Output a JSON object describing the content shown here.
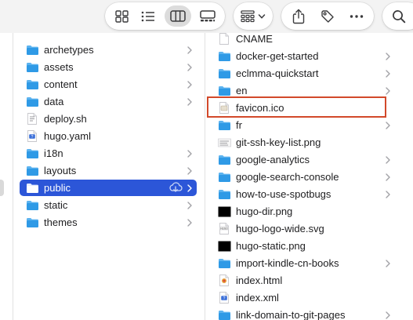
{
  "toolbar": {
    "view_buttons": [
      {
        "icon": "icon-view-icon",
        "active": false
      },
      {
        "icon": "list-view-icon",
        "active": false
      },
      {
        "icon": "column-view-icon",
        "active": true
      },
      {
        "icon": "gallery-view-icon",
        "active": false
      }
    ],
    "group_button_icon": "group-by-icon",
    "share_icon": "share-icon",
    "tag_icon": "tag-icon",
    "more_icon": "more-icon",
    "search_icon": "search-icon"
  },
  "column1": {
    "items": [
      {
        "label": "archetypes",
        "type": "folder",
        "has_children": true
      },
      {
        "label": "assets",
        "type": "folder",
        "has_children": true
      },
      {
        "label": "content",
        "type": "folder",
        "has_children": true
      },
      {
        "label": "data",
        "type": "folder",
        "has_children": true
      },
      {
        "label": "deploy.sh",
        "type": "script",
        "has_children": false
      },
      {
        "label": "hugo.yaml",
        "type": "yaml",
        "has_children": false
      },
      {
        "label": "i18n",
        "type": "folder",
        "has_children": true
      },
      {
        "label": "layouts",
        "type": "folder",
        "has_children": true
      },
      {
        "label": "public",
        "type": "folder",
        "has_children": true,
        "selected": true,
        "cloud": true
      },
      {
        "label": "static",
        "type": "folder",
        "has_children": true
      },
      {
        "label": "themes",
        "type": "folder",
        "has_children": true
      }
    ]
  },
  "column2": {
    "items": [
      {
        "label": "CNAME",
        "type": "text",
        "has_children": false
      },
      {
        "label": "docker-get-started",
        "type": "folder",
        "has_children": true
      },
      {
        "label": "eclmma-quickstart",
        "type": "folder",
        "has_children": true
      },
      {
        "label": "en",
        "type": "folder",
        "has_children": true
      },
      {
        "label": "favicon.ico",
        "type": "ico",
        "has_children": false,
        "highlighted": true
      },
      {
        "label": "fr",
        "type": "folder",
        "has_children": true
      },
      {
        "label": "git-ssh-key-list.png",
        "type": "png-light",
        "has_children": false
      },
      {
        "label": "google-analytics",
        "type": "folder",
        "has_children": true
      },
      {
        "label": "google-search-console",
        "type": "folder",
        "has_children": true
      },
      {
        "label": "how-to-use-spotbugs",
        "type": "folder",
        "has_children": true
      },
      {
        "label": "hugo-dir.png",
        "type": "png-dark",
        "has_children": false
      },
      {
        "label": "hugo-logo-wide.svg",
        "type": "svg",
        "has_children": false
      },
      {
        "label": "hugo-static.png",
        "type": "png-dark",
        "has_children": false
      },
      {
        "label": "import-kindle-cn-books",
        "type": "folder",
        "has_children": true
      },
      {
        "label": "index.html",
        "type": "html",
        "has_children": false
      },
      {
        "label": "index.xml",
        "type": "xml",
        "has_children": false
      },
      {
        "label": "link-domain-to-git-pages",
        "type": "folder",
        "has_children": true
      }
    ]
  },
  "colors": {
    "folder": "#2f9ae6",
    "selection": "#2c56d8",
    "highlight_border": "#d2492a"
  }
}
